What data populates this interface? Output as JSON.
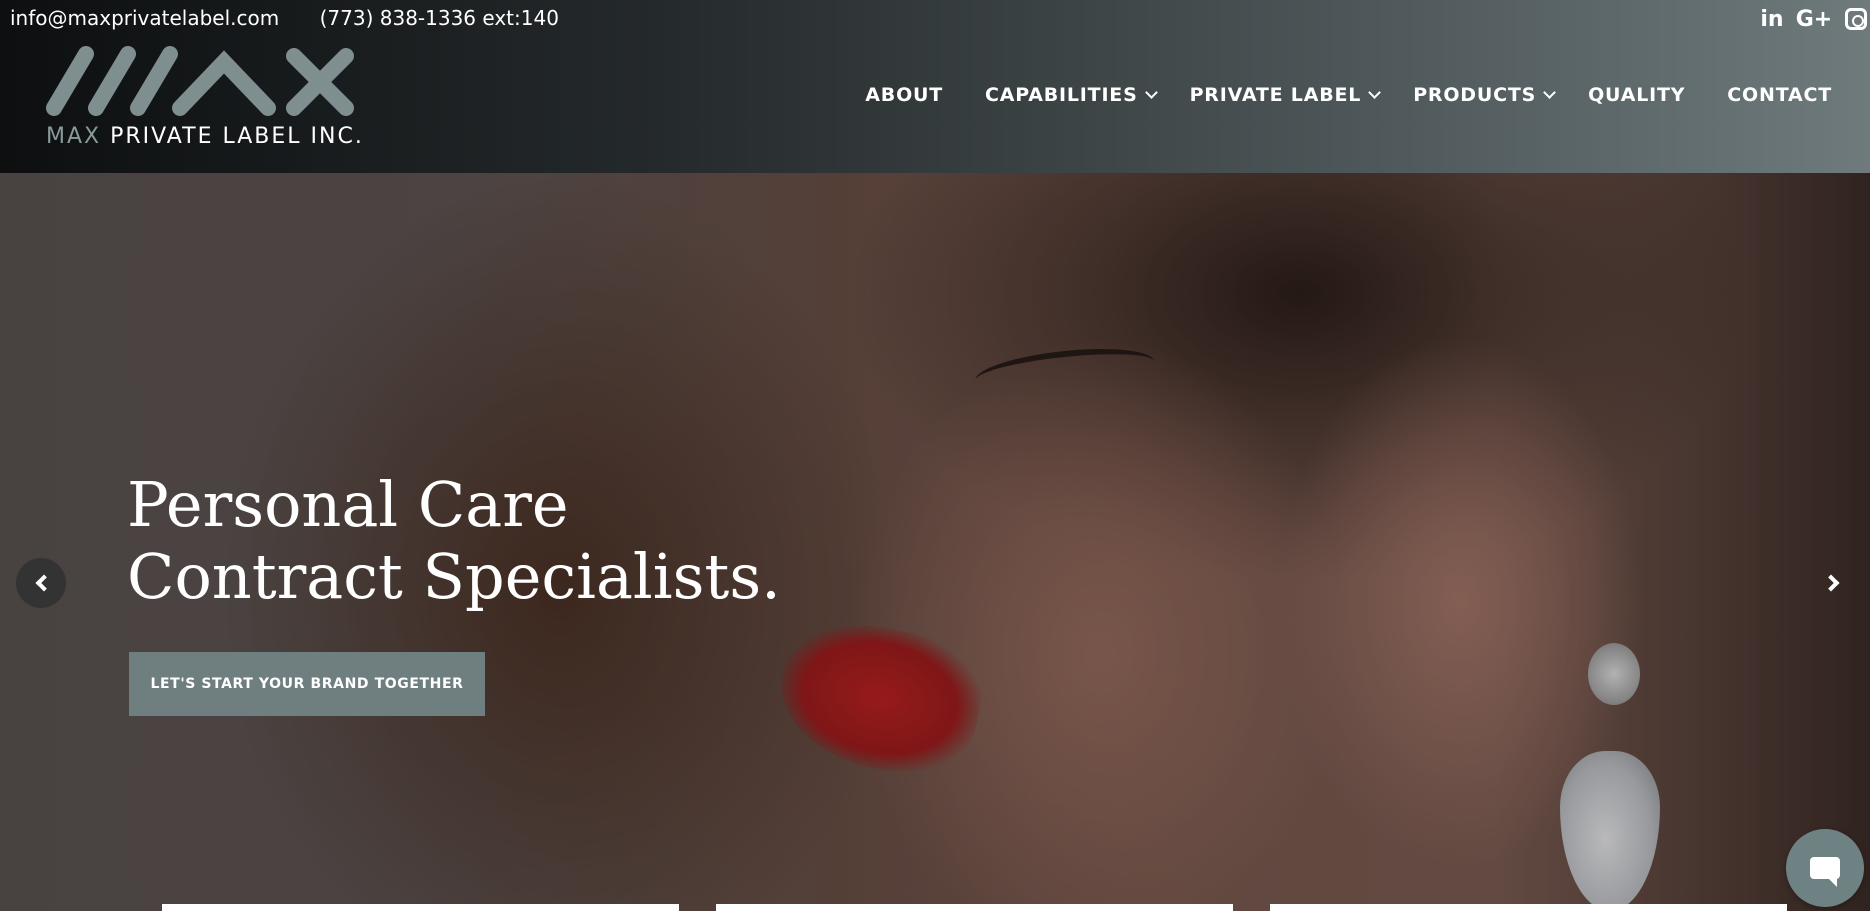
{
  "topbar": {
    "email": "info@maxprivatelabel.com",
    "phone": "(773) 838-1336 ext:140"
  },
  "social": {
    "linkedin_label": "in",
    "google_label": "G+"
  },
  "logo": {
    "brand_word": "MAX",
    "rest": "PRIVATE LABEL INC."
  },
  "nav": {
    "items": [
      {
        "label": "ABOUT"
      },
      {
        "label": "CAPABILITIES"
      },
      {
        "label": "PRIVATE LABEL"
      },
      {
        "label": "PRODUCTS"
      },
      {
        "label": "QUALITY"
      },
      {
        "label": "CONTACT"
      }
    ]
  },
  "hero": {
    "headline_line1": "Personal Care",
    "headline_line2": "Contract Specialists.",
    "cta_label": "LET'S START YOUR BRAND TOGETHER"
  },
  "colors": {
    "accent": "#6f7f80",
    "logo_gray": "#8a9a9b"
  }
}
